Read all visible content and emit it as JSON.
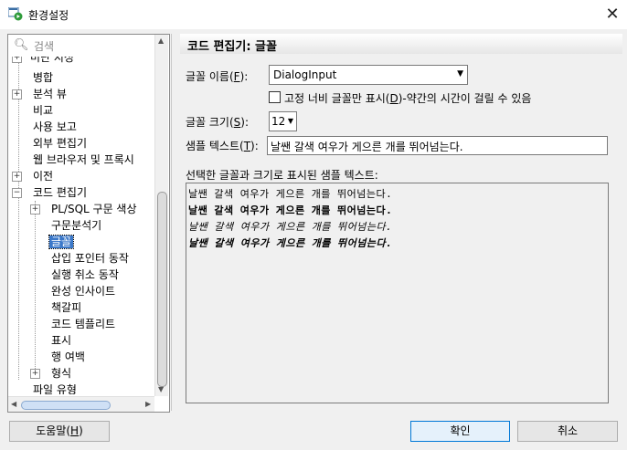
{
  "window": {
    "title": "환경설정",
    "close_icon": "close-icon"
  },
  "search": {
    "placeholder": "검색"
  },
  "tree": {
    "partial_top": "미단 지성",
    "items": [
      {
        "label": "병합"
      },
      {
        "label": "분석 뷰"
      },
      {
        "label": "비교"
      },
      {
        "label": "사용 보고"
      },
      {
        "label": "외부 편집기"
      },
      {
        "label": "웹 브라우저 및 프록시"
      },
      {
        "label": "이전"
      },
      {
        "label": "코드 편집기"
      },
      {
        "label": "PL/SQL 구문 색상"
      },
      {
        "label": "구문분석기"
      },
      {
        "label": "글꼴"
      },
      {
        "label": "삽입 포인터 동작"
      },
      {
        "label": "실행 취소 동작"
      },
      {
        "label": "완성 인사이트"
      },
      {
        "label": "책갈피"
      },
      {
        "label": "코드 템플리트"
      },
      {
        "label": "표시"
      },
      {
        "label": "행 여백"
      },
      {
        "label": "형식"
      },
      {
        "label": "파일 유형"
      }
    ]
  },
  "page": {
    "header": "코드 편집기: 글꼴",
    "font_name": {
      "label_pre": "글꼴 이름(",
      "mnemonic": "F",
      "label_post": "):",
      "value": "DialogInput"
    },
    "fixed_width": {
      "pre": "고정 너비 글꼴만 표시(",
      "mnemonic": "D",
      "post": ")-약간의 시간이 걸릴 수 있음"
    },
    "font_size": {
      "label_pre": "글꼴 크기(",
      "mnemonic": "S",
      "label_post": "):",
      "value": "12"
    },
    "sample_text": {
      "label_pre": "샘플 텍스트(",
      "mnemonic": "T",
      "label_post": "):",
      "value": "날쌘 갈색 여우가 게으른 개를 뛰어넘는다."
    },
    "preview": {
      "label": "선택한 글꼴과 크기로 표시된 샘플 텍스트:",
      "lines": [
        "날쌘 갈색 여우가 게으른 개를 뛰어넘는다.",
        "날쌘 갈색 여우가 게으른 개를 뛰어넘는다.",
        "날쌘 갈색 여우가 게으른 개를 뛰어넘는다.",
        "날쌘 갈색 여우가 게으른 개를 뛰어넘는다."
      ]
    }
  },
  "buttons": {
    "help": {
      "pre": "도움말(",
      "mnemonic": "H",
      "post": ")"
    },
    "ok": "확인",
    "cancel": "취소"
  }
}
